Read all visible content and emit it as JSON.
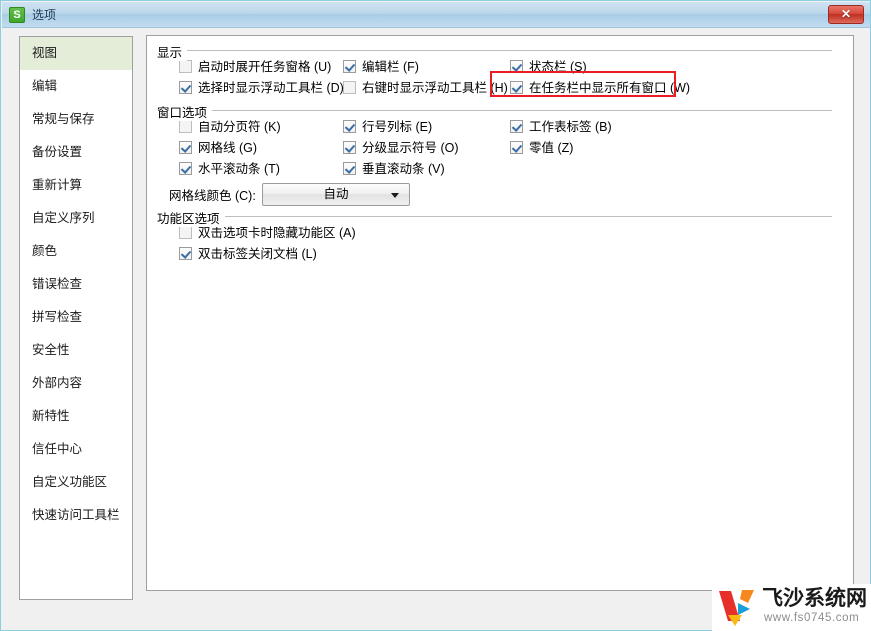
{
  "window": {
    "title": "选项",
    "app_icon": "S",
    "close_label": "✕",
    "close_icon_name": "close-icon"
  },
  "sidebar": {
    "items": [
      {
        "label": "视图",
        "selected": true
      },
      {
        "label": "编辑",
        "selected": false
      },
      {
        "label": "常规与保存",
        "selected": false
      },
      {
        "label": "备份设置",
        "selected": false
      },
      {
        "label": "重新计算",
        "selected": false
      },
      {
        "label": "自定义序列",
        "selected": false
      },
      {
        "label": "颜色",
        "selected": false
      },
      {
        "label": "错误检查",
        "selected": false
      },
      {
        "label": "拼写检查",
        "selected": false
      },
      {
        "label": "安全性",
        "selected": false
      },
      {
        "label": "外部内容",
        "selected": false
      },
      {
        "label": "新特性",
        "selected": false
      },
      {
        "label": "信任中心",
        "selected": false
      },
      {
        "label": "自定义功能区",
        "selected": false
      },
      {
        "label": "快速访问工具栏",
        "selected": false
      }
    ]
  },
  "main": {
    "groups": [
      {
        "legend": "显示",
        "name": "display-group",
        "options": [
          {
            "label": "启动时展开任务窗格 (U)",
            "checked": false,
            "name": "checkbox-expand-task-pane-on-start",
            "col": 0,
            "row": 0
          },
          {
            "label": "编辑栏 (F)",
            "checked": true,
            "name": "checkbox-formula-bar",
            "col": 1,
            "row": 0
          },
          {
            "label": "状态栏 (S)",
            "checked": true,
            "name": "checkbox-status-bar",
            "col": 2,
            "row": 0
          },
          {
            "label": "选择时显示浮动工具栏 (D)",
            "checked": true,
            "name": "checkbox-show-floating-toolbar-on-select",
            "col": 0,
            "row": 1
          },
          {
            "label": "右键时显示浮动工具栏 (H)",
            "checked": false,
            "name": "checkbox-show-floating-toolbar-on-rightclick",
            "col": 1,
            "row": 1
          },
          {
            "label": "在任务栏中显示所有窗口 (W)",
            "checked": true,
            "name": "checkbox-show-all-windows-in-taskbar",
            "col": 2,
            "row": 1
          }
        ]
      },
      {
        "legend": "窗口选项",
        "name": "window-options-group",
        "options": [
          {
            "label": "自动分页符 (K)",
            "checked": false,
            "name": "checkbox-page-breaks",
            "col": 0,
            "row": 0
          },
          {
            "label": "行号列标 (E)",
            "checked": true,
            "name": "checkbox-row-column-headers",
            "col": 1,
            "row": 0
          },
          {
            "label": "工作表标签 (B)",
            "checked": true,
            "name": "checkbox-sheet-tabs",
            "col": 2,
            "row": 0
          },
          {
            "label": "网格线 (G)",
            "checked": true,
            "name": "checkbox-gridlines",
            "col": 0,
            "row": 1
          },
          {
            "label": "分级显示符号 (O)",
            "checked": true,
            "name": "checkbox-outline-symbols",
            "col": 1,
            "row": 1
          },
          {
            "label": "零值 (Z)",
            "checked": true,
            "name": "checkbox-zero-values",
            "col": 2,
            "row": 1
          },
          {
            "label": "水平滚动条 (T)",
            "checked": true,
            "name": "checkbox-horizontal-scrollbar",
            "col": 0,
            "row": 2
          },
          {
            "label": "垂直滚动条 (V)",
            "checked": true,
            "name": "checkbox-vertical-scrollbar",
            "col": 1,
            "row": 2
          }
        ]
      },
      {
        "legend": "功能区选项",
        "name": "ribbon-options-group",
        "options": [
          {
            "label": "双击选项卡时隐藏功能区 (A)",
            "checked": false,
            "name": "checkbox-hide-ribbon-on-doubleclick",
            "col": 0,
            "row": 0
          },
          {
            "label": "双击标签关闭文档 (L)",
            "checked": true,
            "name": "checkbox-close-doc-on-doubleclick-tab",
            "col": 0,
            "row": 1
          }
        ]
      }
    ],
    "gridline_color": {
      "label": "网格线颜色 (C):",
      "value": "自动",
      "options": [
        "自动"
      ]
    }
  },
  "highlight": {
    "target": "checkbox-show-all-windows-in-taskbar",
    "color": "#ec1c24"
  },
  "watermark": {
    "title": "飞沙系统网",
    "url": "www.fs0745.com"
  },
  "colors": {
    "titlebar_accent": "#a9cde6",
    "sidebar_selected": "#e3edd7",
    "app_icon_green": "#3fa72c",
    "close_red": "#bf2e20",
    "highlight_red": "#ec1c24",
    "checkmark_blue": "#3a6ea5"
  }
}
